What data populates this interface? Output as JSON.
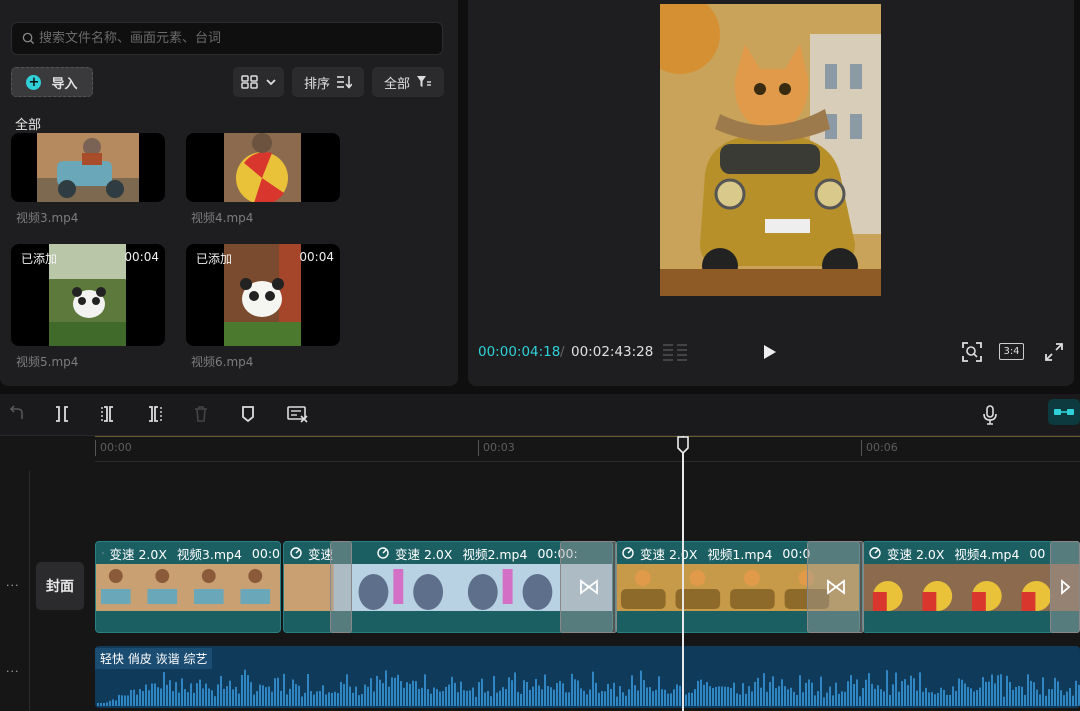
{
  "media": {
    "search_placeholder": "搜索文件名称、画面元素、台词",
    "import_label": "导入",
    "sort_label": "排序",
    "filter_label": "全部",
    "section_label": "全部",
    "thumbnails": [
      {
        "name": "视频3.mp4",
        "added": "",
        "duration": ""
      },
      {
        "name": "视频4.mp4",
        "added": "",
        "duration": ""
      },
      {
        "name": "视频5.mp4",
        "added": "已添加",
        "duration": "00:04"
      },
      {
        "name": "视频6.mp4",
        "added": "已添加",
        "duration": "00:04"
      }
    ]
  },
  "preview": {
    "current_time": "00:00:04:18",
    "separator": "/",
    "total_time": "00:02:43:28",
    "ratio_label": "3:4"
  },
  "timeline": {
    "ruler": [
      "00:00",
      "00:03",
      "00:06"
    ],
    "cover_label": "封面",
    "clips": [
      {
        "speed": "变速 2.0X",
        "name": "视频3.mp4",
        "time": "00:0"
      },
      {
        "speed": "变速 2.0X",
        "name": "视频2.mp4",
        "time": "00:00:"
      },
      {
        "speed": "变速 2.0X",
        "name": "视频1.mp4",
        "time": "00:0"
      },
      {
        "speed": "变速 2.0X",
        "name": "视频4.mp4",
        "time": "00"
      }
    ],
    "clip_partial_label": "变速",
    "audio_label": "轻快 俏皮 诙谐 综艺",
    "track_menu": "···"
  },
  "colors": {
    "accent": "#2fd0d7",
    "clip": "#1c5f63",
    "audio": "#0f3a5a",
    "panel": "#1e1e20"
  },
  "icons": [
    "search-icon",
    "plus-icon",
    "grid-view-icon",
    "chevron-down-icon",
    "sort-icon",
    "filter-icon",
    "play-icon",
    "zoom-fit-icon",
    "fullscreen-icon",
    "undo-icon",
    "split-icon",
    "split-left-icon",
    "split-right-icon",
    "delete-icon",
    "marker-icon",
    "caption-delete-icon",
    "microphone-icon",
    "link-tracks-icon",
    "transition-icon",
    "speed-icon"
  ]
}
